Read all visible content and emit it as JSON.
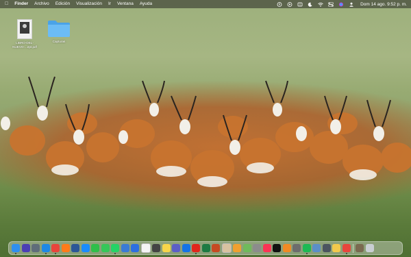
{
  "menubar": {
    "apple_icon": "apple-logo-icon",
    "items": [
      "Finder",
      "Archivo",
      "Edición",
      "Visualización",
      "Ir",
      "Ventana",
      "Ayuda"
    ],
    "status_icons": [
      "battery-status-icon",
      "play-icon",
      "control-icon",
      "moon-icon",
      "wifi-icon",
      "control-center-icon",
      "siri-icon",
      "user-icon"
    ],
    "clock": "Dom 14 ago.  9:52 p. m."
  },
  "desktop": {
    "icons": [
      {
        "label": "LIBRO-DEL-NUEVO-...ept.pdf",
        "type": "pdf-file-icon"
      },
      {
        "label": "Capturas",
        "type": "folder-icon"
      }
    ]
  },
  "dock": {
    "apps": [
      {
        "name": "finder-icon",
        "color": "#2f8ff0"
      },
      {
        "name": "siri-icon",
        "color": "#4b3fb5"
      },
      {
        "name": "launchpad-icon",
        "color": "#5f6d7a"
      },
      {
        "name": "safari-icon",
        "color": "#1e88e5"
      },
      {
        "name": "chrome-icon",
        "color": "#e8453c"
      },
      {
        "name": "firefox-icon",
        "color": "#ff7b1a"
      },
      {
        "name": "word-icon",
        "color": "#2b5797"
      },
      {
        "name": "app-store-icon",
        "color": "#1a8cff"
      },
      {
        "name": "facetime-icon",
        "color": "#2fbf4a"
      },
      {
        "name": "messages-icon",
        "color": "#35c759"
      },
      {
        "name": "whatsapp-icon",
        "color": "#25d366"
      },
      {
        "name": "mail-icon",
        "color": "#3a7bd5"
      },
      {
        "name": "keynote-icon",
        "color": "#2d6fe0"
      },
      {
        "name": "calendar-icon",
        "color": "#f4f4f4"
      },
      {
        "name": "calculator-icon",
        "color": "#444444"
      },
      {
        "name": "notes-icon",
        "color": "#f7d54a"
      },
      {
        "name": "teams-icon",
        "color": "#5b5fc7"
      },
      {
        "name": "outlook-icon",
        "color": "#1473e6"
      },
      {
        "name": "acrobat-icon",
        "color": "#e0261c"
      },
      {
        "name": "excel-icon",
        "color": "#1d7a43"
      },
      {
        "name": "powerpoint-icon",
        "color": "#c64a23"
      },
      {
        "name": "contacts-icon",
        "color": "#d8c2a0"
      },
      {
        "name": "photos-icon",
        "color": "#f0a030"
      },
      {
        "name": "maps-icon",
        "color": "#6fba5c"
      },
      {
        "name": "tools-icon",
        "color": "#8c8c8c"
      },
      {
        "name": "music-icon",
        "color": "#fa3455"
      },
      {
        "name": "tv-icon",
        "color": "#111111"
      },
      {
        "name": "books-icon",
        "color": "#f08a24"
      },
      {
        "name": "system-preferences-icon",
        "color": "#6d6d6d"
      },
      {
        "name": "spotify-icon",
        "color": "#1db954"
      },
      {
        "name": "preview-icon",
        "color": "#5b8fc8"
      },
      {
        "name": "display-icon",
        "color": "#4b5560"
      },
      {
        "name": "notes-app-icon",
        "color": "#f2c94c"
      },
      {
        "name": "chrome-alt-icon",
        "color": "#e8453c"
      }
    ],
    "extras": [
      {
        "name": "downloads-stack-icon",
        "color": "#7a6a50"
      },
      {
        "name": "trash-icon",
        "color": "#c9ced3"
      }
    ]
  }
}
